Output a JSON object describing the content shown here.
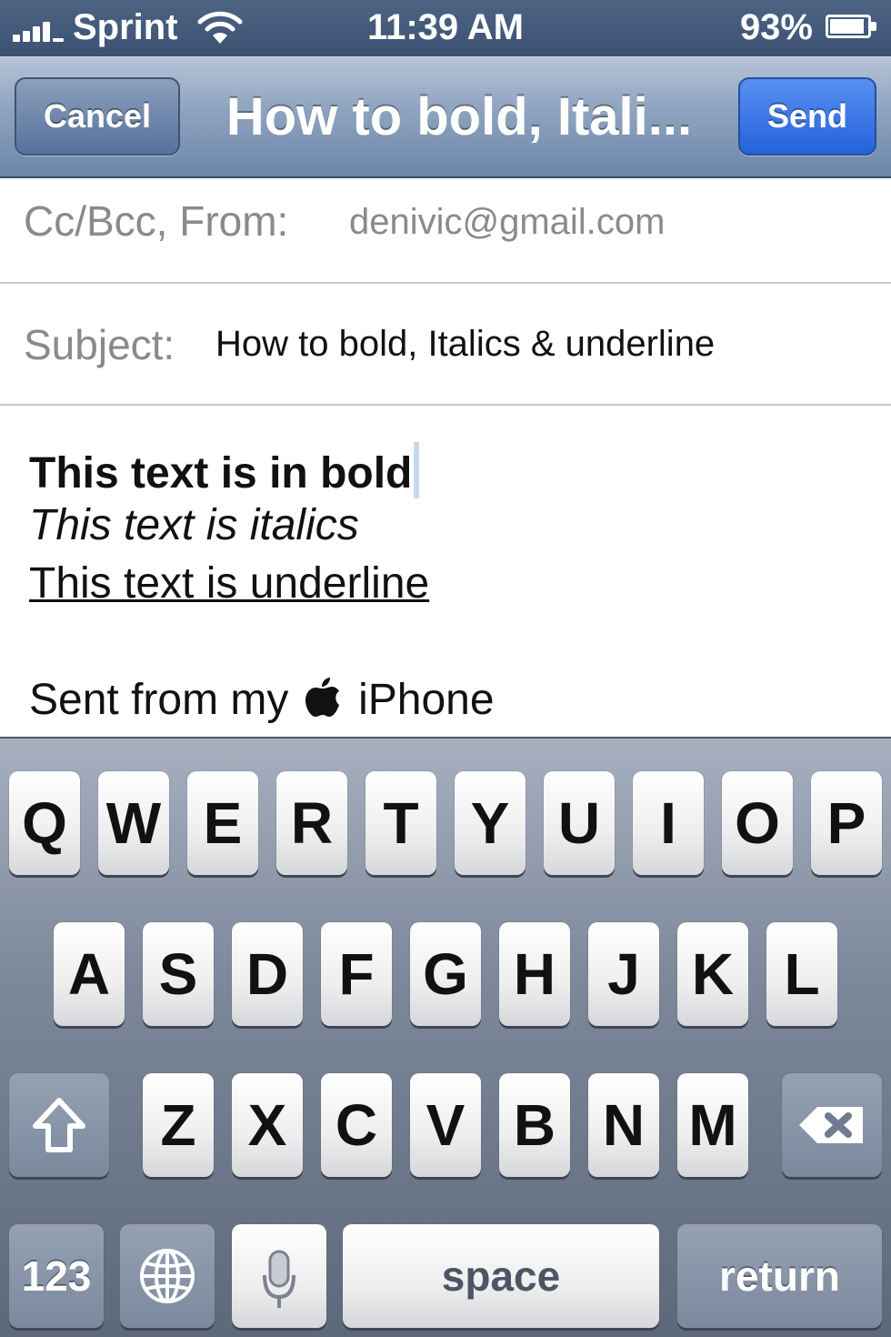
{
  "status_bar": {
    "carrier": "Sprint",
    "time": "11:39 AM",
    "battery": "93%"
  },
  "nav": {
    "cancel_label": "Cancel",
    "title": "How to bold, Itali...",
    "send_label": "Send"
  },
  "fields": {
    "from_label": "Cc/Bcc, From:",
    "from_value": "denivic@gmail.com",
    "subject_label": "Subject:",
    "subject_value": "How to bold, Italics & underline"
  },
  "body": {
    "bold_line": "This text is in bold",
    "italic_line": "This text is italics",
    "underline_line": "This text is underline",
    "signature_prefix": "Sent from my",
    "signature_suffix": "iPhone"
  },
  "keyboard": {
    "row1": [
      "Q",
      "W",
      "E",
      "R",
      "T",
      "Y",
      "U",
      "I",
      "O",
      "P"
    ],
    "row2": [
      "A",
      "S",
      "D",
      "F",
      "G",
      "H",
      "J",
      "K",
      "L"
    ],
    "row3": [
      "Z",
      "X",
      "C",
      "V",
      "B",
      "N",
      "M"
    ],
    "numbers_label": "123",
    "space_label": "space",
    "return_label": "return"
  },
  "icons": {
    "shift": "shift-icon",
    "delete": "delete-icon",
    "globe": "globe-icon",
    "microphone": "microphone-icon",
    "apple": "apple-icon"
  }
}
